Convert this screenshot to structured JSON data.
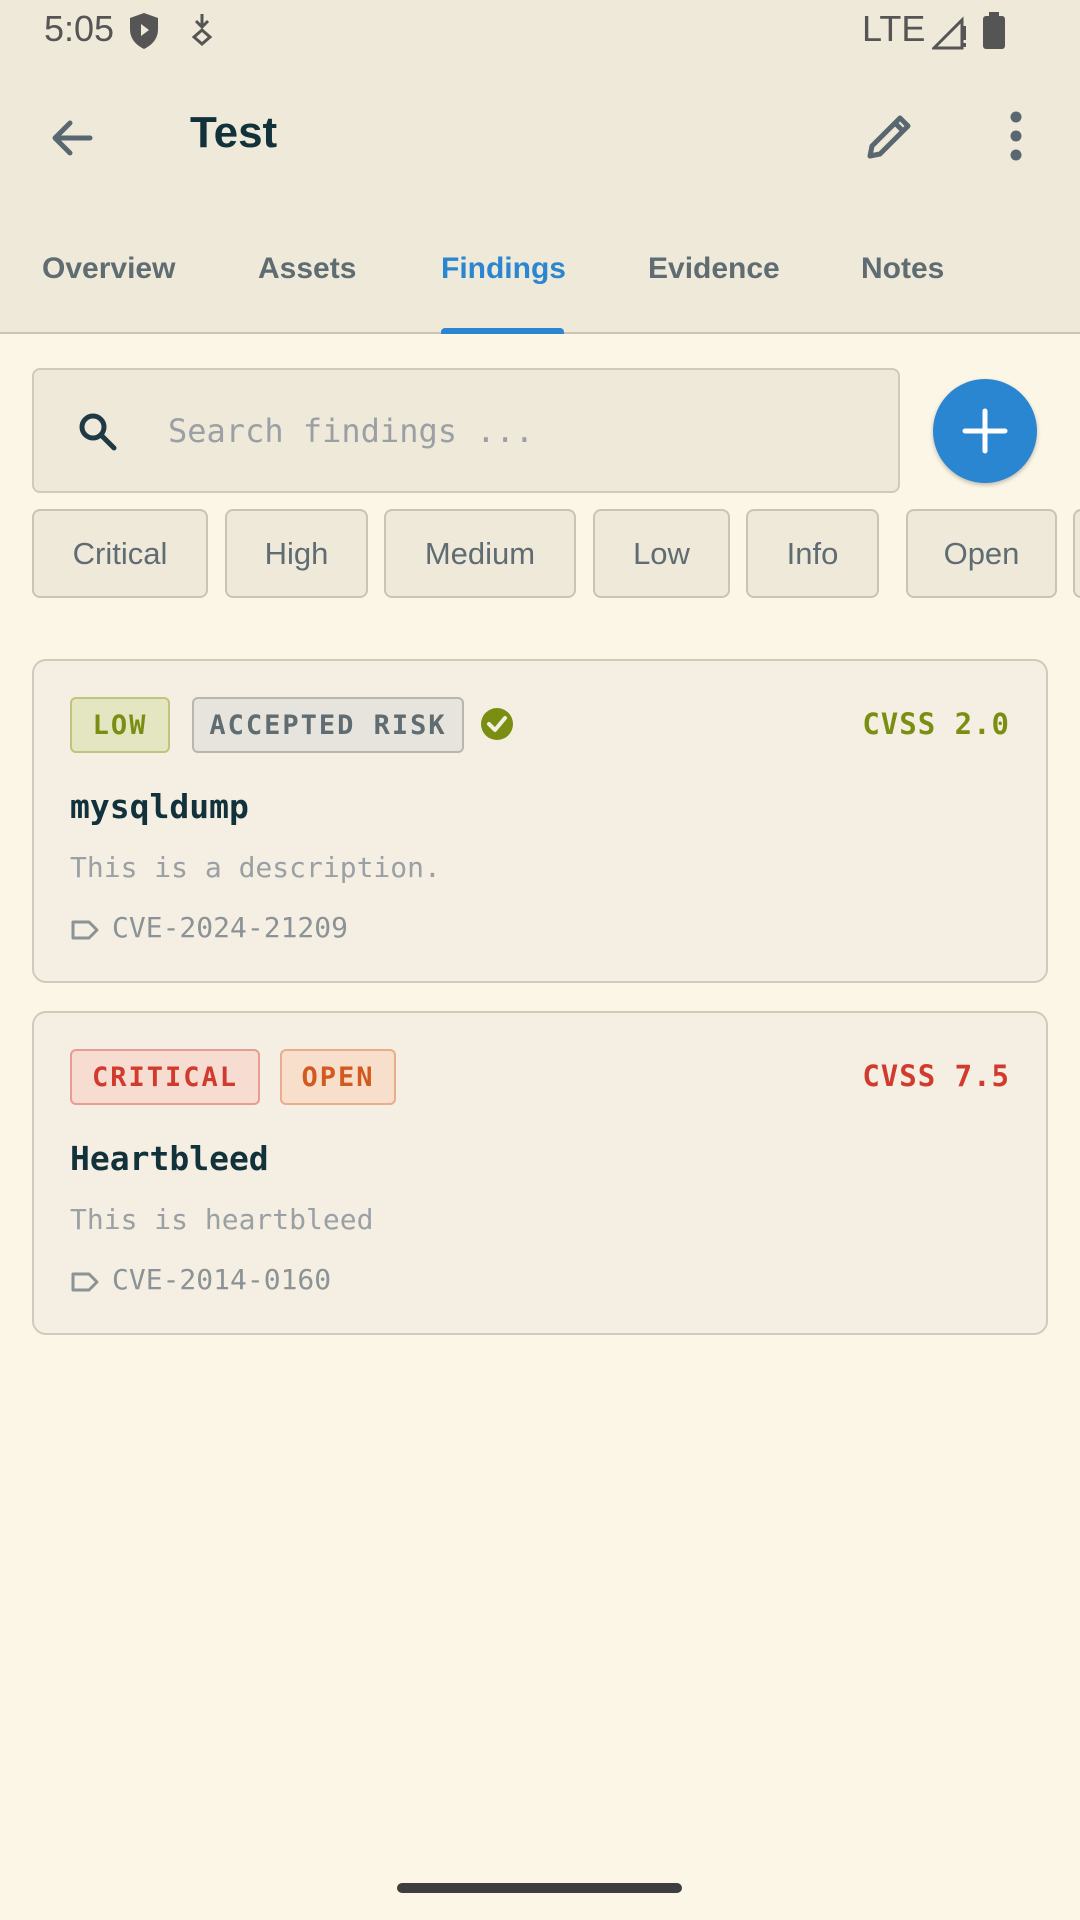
{
  "status_bar": {
    "time": "5:05",
    "network": "LTE"
  },
  "app_bar": {
    "title": "Test"
  },
  "tabs": [
    {
      "label": "Overview"
    },
    {
      "label": "Assets"
    },
    {
      "label": "Findings"
    },
    {
      "label": "Evidence"
    },
    {
      "label": "Notes"
    }
  ],
  "active_tab": "Findings",
  "search": {
    "placeholder": "Search findings ..."
  },
  "filters": [
    {
      "label": "Critical"
    },
    {
      "label": "High"
    },
    {
      "label": "Medium"
    },
    {
      "label": "Low"
    },
    {
      "label": "Info"
    },
    {
      "label": "Open"
    }
  ],
  "findings": [
    {
      "severity": "LOW",
      "status": "ACCEPTED RISK",
      "cvss": "CVSS 2.0",
      "name": "mysqldump",
      "description": "This is a description.",
      "cve": "CVE-2024-21209"
    },
    {
      "severity": "CRITICAL",
      "status": "OPEN",
      "cvss": "CVSS 7.5",
      "name": "Heartbleed",
      "description": "This is heartbleed",
      "cve": "CVE-2014-0160"
    }
  ],
  "colors": {
    "accent": "#2a86d1",
    "low": "#7a8f12",
    "critical": "#d13b2e",
    "open": "#d2591f",
    "background": "#fcf6e7"
  },
  "icons": [
    "shield-icon",
    "download-icon",
    "signal-icon",
    "battery-icon",
    "back-arrow-icon",
    "edit-icon",
    "more-vert-icon",
    "search-icon",
    "add-icon",
    "check-circle-icon",
    "tag-icon"
  ]
}
